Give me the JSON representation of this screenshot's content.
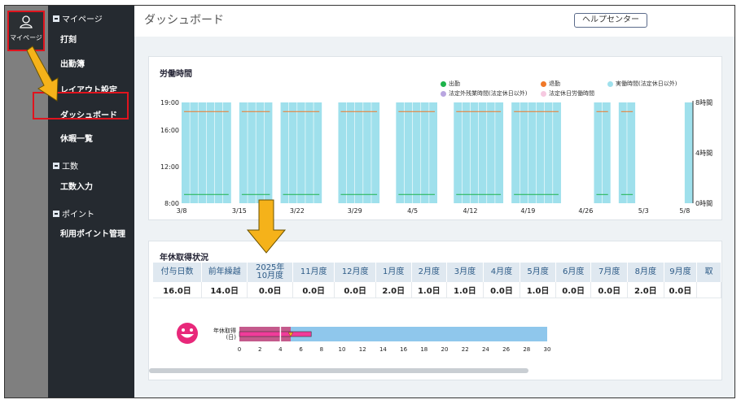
{
  "mypage_button": {
    "label": "マイページ"
  },
  "sidebar": {
    "sections": [
      {
        "label": "マイページ",
        "items": [
          "打刻",
          "出勤簿",
          "レイアウト設定",
          "ダッシュボード",
          "休暇一覧"
        ]
      },
      {
        "label": "工数",
        "items": [
          "工数入力"
        ]
      },
      {
        "label": "ポイント",
        "items": [
          "利用ポイント管理"
        ]
      }
    ]
  },
  "header": {
    "title": "ダッシュボード",
    "help_label": "ヘルプセンター"
  },
  "work_card": {
    "title": "労働時間",
    "legend": [
      {
        "label": "出勤",
        "color": "#1db34b"
      },
      {
        "label": "退勤",
        "color": "#f07828"
      },
      {
        "label": "実働時間(法定休日以外)",
        "color": "#9fe0ec"
      },
      {
        "label": "法定外残業時間(法定休日以外)",
        "color": "#b9a6e0"
      },
      {
        "label": "法定休日労働時間",
        "color": "#f6c9e0"
      }
    ]
  },
  "chart_data": {
    "type": "bar",
    "y_left_ticks": [
      "19:00",
      "16:00",
      "12:00",
      "8:00"
    ],
    "y_right_ticks": [
      "8時間",
      "4時間",
      "0時間"
    ],
    "x_ticks": [
      "3/8",
      "3/15",
      "3/22",
      "3/29",
      "4/5",
      "4/12",
      "4/19",
      "4/26",
      "5/3",
      "5/8"
    ],
    "series": [
      {
        "name": "出勤",
        "time": "8:57",
        "color": "#1db34b"
      },
      {
        "name": "退勤",
        "time": "18:00",
        "color": "#f07828"
      },
      {
        "name": "実働時間(法定休日以外)",
        "color": "#9fe0ec"
      }
    ],
    "workday_groups": [
      {
        "days": [
          0,
          1,
          2,
          3,
          4,
          5
        ],
        "clock": true
      },
      {
        "days": [
          7,
          8,
          9,
          10
        ],
        "clock": true
      },
      {
        "days": [
          12,
          13,
          14,
          15,
          16
        ],
        "clock": true
      },
      {
        "days": [
          19,
          20,
          21,
          22,
          23
        ],
        "clock": true
      },
      {
        "days": [
          26,
          27,
          28,
          29,
          30
        ],
        "clock": true
      },
      {
        "days": [
          33,
          34,
          35,
          36,
          37,
          38
        ],
        "clock": true
      },
      {
        "days": [
          40,
          41,
          42,
          43,
          44,
          45
        ],
        "clock": true
      },
      {
        "days": [
          50,
          51
        ],
        "clock": true
      },
      {
        "days": [
          53,
          54
        ],
        "clock": true
      },
      {
        "days": [
          61
        ],
        "clock": false
      }
    ],
    "ylim": [
      "8:00",
      "19:00"
    ]
  },
  "leave_card": {
    "title": "年休取得状況",
    "headers": [
      "付与日数",
      "前年繰越",
      "2025年\n10月度",
      "11月度",
      "12月度",
      "1月度",
      "2月度",
      "3月度",
      "4月度",
      "5月度",
      "6月度",
      "7月度",
      "8月度",
      "9月度",
      "取"
    ],
    "values": [
      "16.0日",
      "14.0日",
      "0.0日",
      "0.0日",
      "0.0日",
      "2.0日",
      "1.0日",
      "1.0日",
      "0.0日",
      "1.0日",
      "0.0日",
      "0.0日",
      "2.0日",
      "0.0日",
      ""
    ],
    "gauge": {
      "label_line1": "年休取得",
      "label_line2": "(日)",
      "total_days": 30,
      "taken_days": 5,
      "pink_bar_days": 7,
      "marker_days": 5,
      "target_line_days": 4,
      "ticks": [
        "0",
        "2",
        "4",
        "6",
        "8",
        "10",
        "12",
        "14",
        "16",
        "18",
        "20",
        "22",
        "24",
        "26",
        "28",
        "30"
      ]
    }
  },
  "annotations": {
    "highlight_color": "#e0141e",
    "arrow_color": "#f5b21a"
  }
}
